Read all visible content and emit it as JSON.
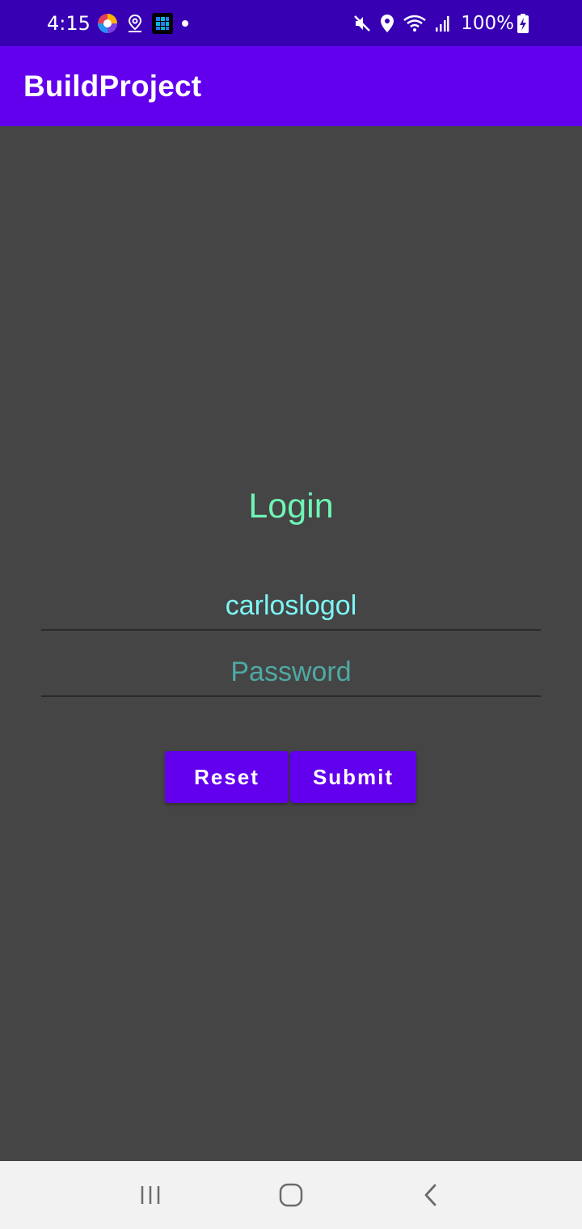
{
  "status_bar": {
    "time": "4:15",
    "battery": "100%",
    "icons": [
      "browser-icon",
      "location-pin-icon",
      "app-grid-icon",
      "notification-dot-icon",
      "mute-icon",
      "location-icon",
      "wifi-icon",
      "signal-icon",
      "battery-charging-icon"
    ]
  },
  "app_bar": {
    "title": "BuildProject"
  },
  "login": {
    "title": "Login",
    "username_value": "carloslogol",
    "password_placeholder": "Password",
    "reset_label": "Reset",
    "submit_label": "Submit"
  },
  "colors": {
    "status_bar": "#3700b3",
    "app_bar": "#6200ee",
    "background": "#454545",
    "title_text": "#6ef5b6",
    "input_text": "#7ef6f6",
    "placeholder_text": "#4ea9a3",
    "nav_bar": "#f2f2f2"
  },
  "nav_bar": {
    "icons": [
      "recents-icon",
      "home-icon",
      "back-icon"
    ]
  }
}
